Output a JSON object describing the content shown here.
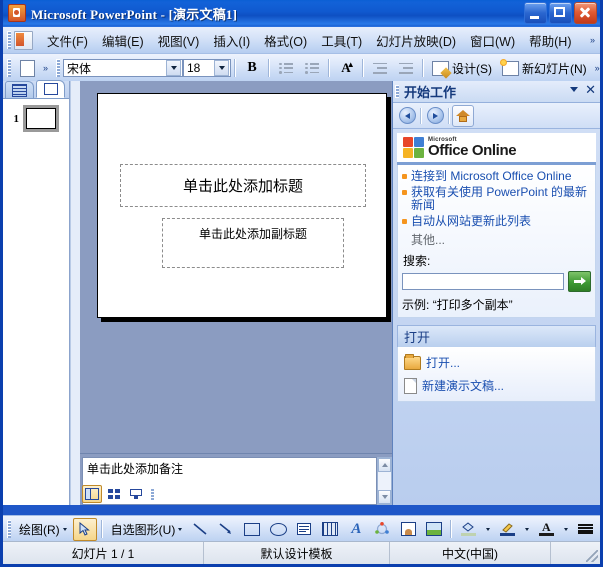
{
  "window": {
    "title": "Microsoft PowerPoint - [演示文稿1]",
    "icon": "powerpoint-icon",
    "buttons": {
      "minimize": "minimize-button",
      "maximize": "maximize-button",
      "close": "close-button"
    }
  },
  "menubar": {
    "items": [
      {
        "label": "文件(F)"
      },
      {
        "label": "编辑(E)"
      },
      {
        "label": "视图(V)"
      },
      {
        "label": "插入(I)"
      },
      {
        "label": "格式(O)"
      },
      {
        "label": "工具(T)"
      },
      {
        "label": "幻灯片放映(D)"
      },
      {
        "label": "窗口(W)"
      },
      {
        "label": "帮助(H)"
      }
    ]
  },
  "toolbar": {
    "font_name": "宋体",
    "font_size": "18",
    "bold_label": "B",
    "design_label": "设计(S)",
    "new_slide_label": "新幻灯片(N)"
  },
  "left_pane": {
    "tabs": [
      {
        "label": "大纲",
        "icon": "outline-tab-icon",
        "active": false
      },
      {
        "label": "幻灯片",
        "icon": "slides-tab-icon",
        "active": true
      }
    ],
    "slides": [
      {
        "number": "1"
      }
    ]
  },
  "slide": {
    "title_placeholder": "单击此处添加标题",
    "subtitle_placeholder": "单击此处添加副标题"
  },
  "notes": {
    "placeholder": "单击此处添加备注"
  },
  "view_buttons": [
    {
      "name": "normal-view",
      "selected": true
    },
    {
      "name": "slide-sorter-view",
      "selected": false
    },
    {
      "name": "slide-show-view",
      "selected": false
    }
  ],
  "task_pane": {
    "title": "开始工作",
    "nav": {
      "back": "back-button",
      "forward": "forward-button",
      "home": "home-button"
    },
    "logo": {
      "microsoft": "Microsoft",
      "office_online": "Office Online",
      "colors": [
        "#e8462a",
        "#3f7fd4",
        "#f5b324",
        "#6cb33f"
      ]
    },
    "links": [
      {
        "label": "连接到 Microsoft Office Online"
      },
      {
        "label": "获取有关使用 PowerPoint 的最新新闻"
      },
      {
        "label": "自动从网站更新此列表"
      }
    ],
    "more_label": "其他...",
    "search": {
      "label": "搜索:",
      "value": "",
      "placeholder": "",
      "go_button": "go-button",
      "example_label": "示例:",
      "example_text": "“打印多个副本”"
    },
    "open_section": {
      "header": "打开",
      "items": [
        {
          "label": "打开...",
          "icon": "folder-icon"
        },
        {
          "label": "新建演示文稿...",
          "icon": "document-icon"
        }
      ]
    }
  },
  "drawing_toolbar": {
    "draw_label": "绘图(R)",
    "autoshapes_label": "自选图形(U)",
    "tools": [
      "select-arrow-tool",
      "line-tool",
      "arrow-tool",
      "rectangle-tool",
      "oval-tool",
      "text-box-tool",
      "insert-table-tool",
      "wordart-tool",
      "diagram-tool",
      "clipart-tool",
      "picture-tool",
      "fill-color-tool",
      "line-color-tool",
      "font-color-tool",
      "line-style-tool",
      "dash-style-tool"
    ]
  },
  "statusbar": {
    "slide_info": "幻灯片 1 / 1",
    "template": "默认设计模板",
    "language": "中文(中国)"
  }
}
